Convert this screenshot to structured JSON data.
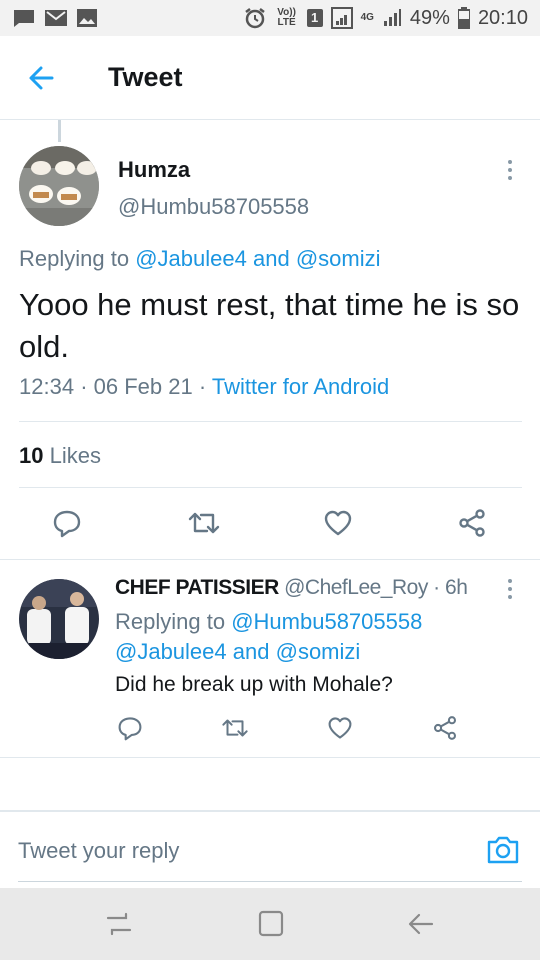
{
  "status_bar": {
    "volte": "Vo)) LTE",
    "sim": "1",
    "network": "4G",
    "battery": "49%",
    "time": "20:10"
  },
  "header": {
    "title": "Tweet"
  },
  "main_tweet": {
    "name": "Humza",
    "handle": "@Humbu58705558",
    "replying_prefix": "Replying to",
    "reply_user_1": "@Jabulee4",
    "reply_and": "and",
    "reply_user_2": "@somizi",
    "text": "Yooo he must rest, that time he is so old.",
    "time": "12:34",
    "date": "06 Feb 21",
    "source": "Twitter for Android",
    "likes_count": "10",
    "likes_label": "Likes"
  },
  "reply_tweet": {
    "name": "CHEF PATISSIER",
    "handle": "@ChefLee_Roy",
    "age": "6h",
    "replying_prefix": "Replying to",
    "reply_user_1": "@Humbu58705558",
    "reply_user_2": "@Jabulee4",
    "reply_and": "and",
    "reply_user_3": "@somizi",
    "text": "Did he break up with Mohale?"
  },
  "reply_bar": {
    "placeholder": "Tweet your reply"
  },
  "icons": {
    "back": "arrow-left-icon",
    "more": "more-vertical-icon",
    "reply": "reply-icon",
    "retweet": "retweet-icon",
    "like": "heart-icon",
    "share": "share-icon",
    "camera": "camera-icon"
  },
  "colors": {
    "accent": "#1da1f2",
    "link": "#1b95e0",
    "text": "#14171a",
    "secondary": "#657786"
  }
}
